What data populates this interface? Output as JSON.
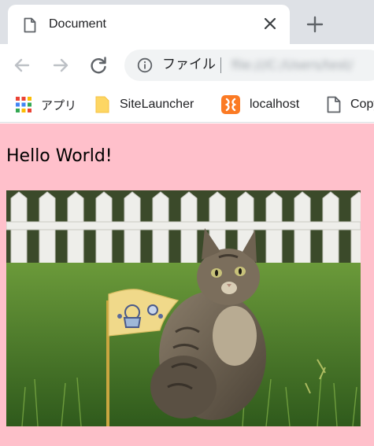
{
  "browser": {
    "tab": {
      "title": "Document",
      "icon": "document-icon"
    },
    "new_tab_icon": "plus-icon",
    "toolbar": {
      "back_icon": "back-arrow-icon",
      "forward_icon": "forward-arrow-icon",
      "reload_icon": "reload-icon",
      "omnibox": {
        "scheme_label": "ファイル",
        "url": "file:///C:/Users/test/"
      }
    },
    "bookmarks": [
      {
        "label": "アプリ",
        "icon": "apps-grid-icon"
      },
      {
        "label": "SiteLauncher",
        "icon": "folder-icon"
      },
      {
        "label": "localhost",
        "icon": "xampp-icon"
      },
      {
        "label": "Copy",
        "icon": "page-icon"
      }
    ]
  },
  "page": {
    "background": "#ffc0cb",
    "heading": "Hello World!",
    "image": {
      "subject": "tabby cat sitting on grass beside a small flag in front of a white picket fence"
    }
  }
}
